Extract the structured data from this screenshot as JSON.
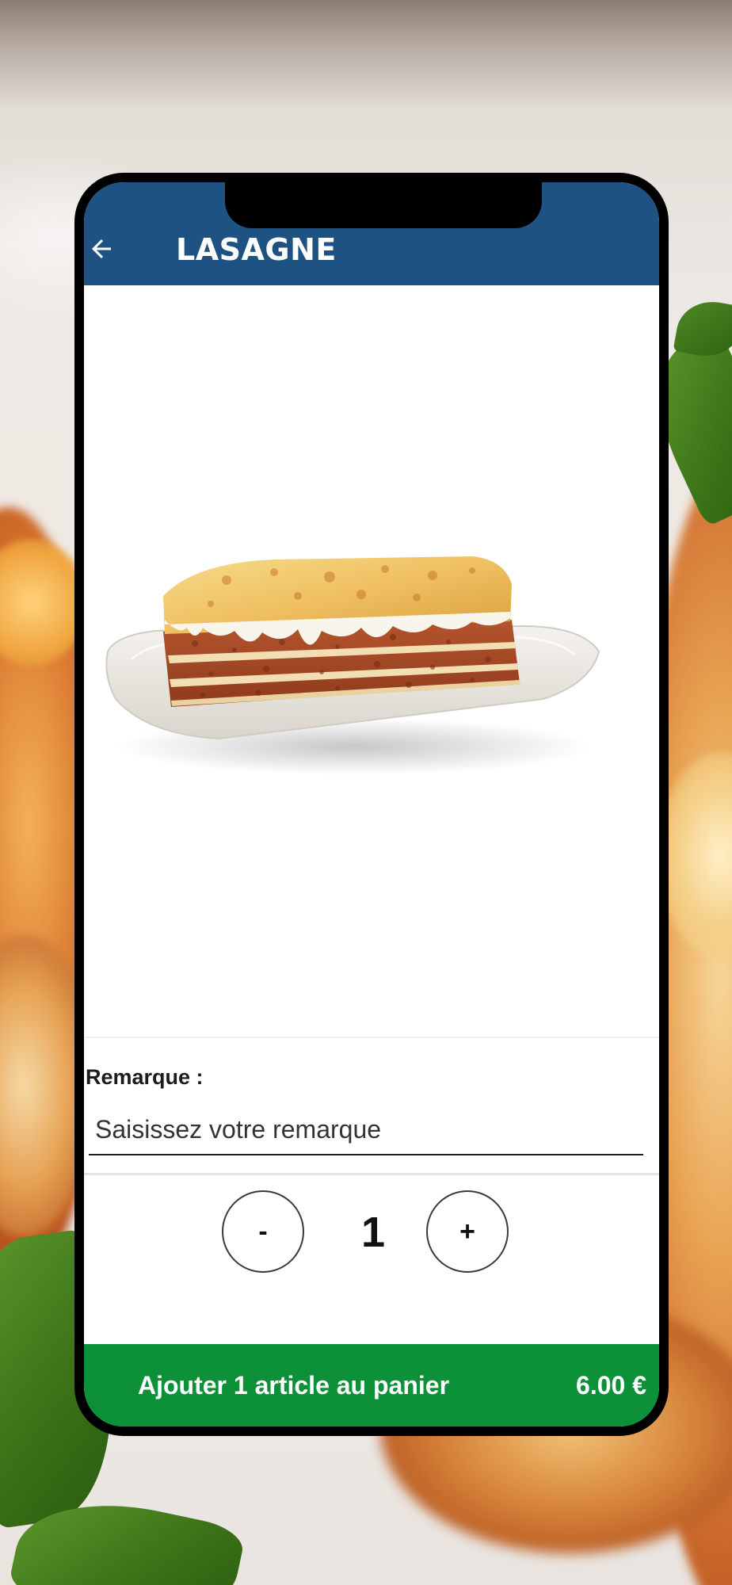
{
  "screen": {
    "title": "LASAGNE",
    "back_icon": "arrow-left-icon"
  },
  "product": {
    "image_subject": "lasagne-dish"
  },
  "remark": {
    "label": "Remarque :",
    "placeholder": "Saisissez votre remarque",
    "value": ""
  },
  "quantity": {
    "minus_label": "-",
    "value": "1",
    "plus_label": "+"
  },
  "cart": {
    "label": "Ajouter 1 article au panier",
    "price": "6.00 €"
  },
  "colors": {
    "header": "#1e5283",
    "cart_button": "#0d9138"
  }
}
